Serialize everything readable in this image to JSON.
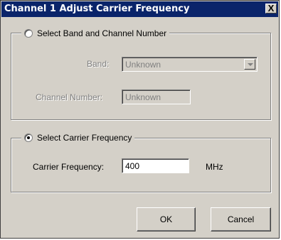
{
  "window": {
    "title": "Channel 1 Adjust Carrier Frequency",
    "close_glyph": "X"
  },
  "band_group": {
    "radio_label": "Select Band and Channel Number",
    "selected": false,
    "band_label": "Band:",
    "band_value": "Unknown",
    "channel_label": "Channel Number:",
    "channel_value": "Unknown"
  },
  "freq_group": {
    "radio_label": "Select Carrier Frequency",
    "selected": true,
    "freq_label": "Carrier Frequency:",
    "freq_value": "400",
    "freq_unit": "MHz"
  },
  "buttons": {
    "ok": "OK",
    "cancel": "Cancel"
  },
  "colors": {
    "titlebar": "#0a246a",
    "face": "#d4d0c8",
    "disabled_text": "#808080"
  }
}
